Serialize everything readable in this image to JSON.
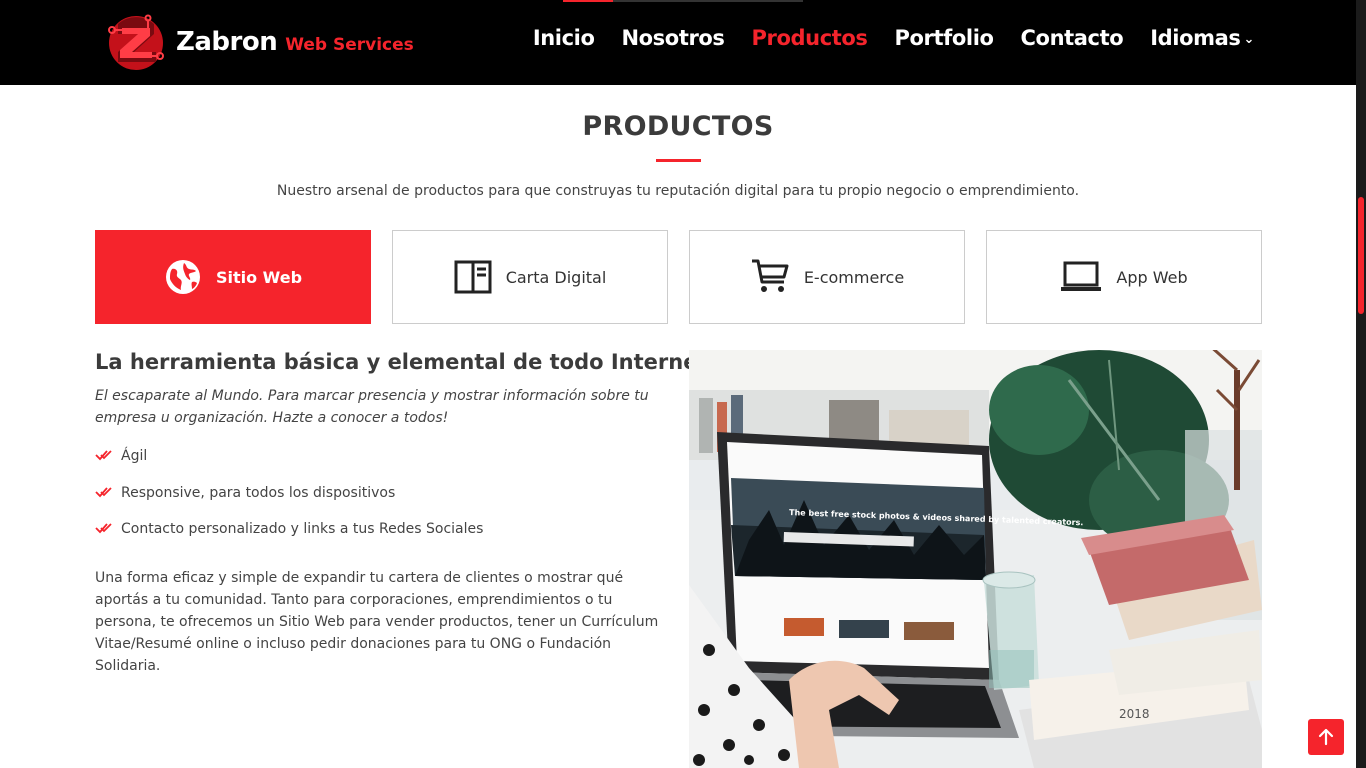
{
  "header": {
    "brand_name": "Zabron",
    "brand_sub": "Web Services",
    "nav": [
      {
        "label": "Inicio",
        "active": false
      },
      {
        "label": "Nosotros",
        "active": false
      },
      {
        "label": "Productos",
        "active": true
      },
      {
        "label": "Portfolio",
        "active": false
      },
      {
        "label": "Contacto",
        "active": false
      },
      {
        "label": "Idiomas",
        "active": false,
        "has_dropdown": true
      }
    ]
  },
  "section": {
    "title": "PRODUCTOS",
    "description": "Nuestro arsenal de productos para que construyas tu reputación digital para tu propio negocio o emprendimiento."
  },
  "tabs": [
    {
      "label": "Sitio Web",
      "icon": "globe-icon",
      "active": true
    },
    {
      "label": "Carta Digital",
      "icon": "menu-book-icon",
      "active": false
    },
    {
      "label": "E-commerce",
      "icon": "shopping-cart-icon",
      "active": false
    },
    {
      "label": "App Web",
      "icon": "laptop-icon",
      "active": false
    }
  ],
  "content": {
    "heading": "La herramienta básica y elemental de todo Internet",
    "intro": "El escaparate al Mundo. Para marcar presencia y mostrar información sobre tu empresa u organización. Hazte a conocer a todos!",
    "features": [
      "Ágil",
      "Responsive, para todos los dispositivos",
      "Contacto personalizado y links a tus Redes Sociales"
    ],
    "body": "Una forma eficaz y simple de expandir tu cartera de clientes o mostrar qué aportás a tu comunidad. Tanto para corporaciones, emprendimientos o tu persona, te ofrecemos un Sitio Web para vender productos, tener un Currículum Vitae/Resumé online o incluso pedir donaciones para tu ONG o Fundación Solidaria."
  },
  "photo": {
    "screen_headline": "The best free stock photos & videos shared by talented creators.",
    "book_year": "2018"
  },
  "colors": {
    "accent": "#f5242c",
    "header_bg": "#000000",
    "text": "#444444",
    "heading": "#3b3b3b"
  },
  "icons": {
    "back_to_top": "arrow-up-icon",
    "feature_bullet": "double-check-icon"
  }
}
